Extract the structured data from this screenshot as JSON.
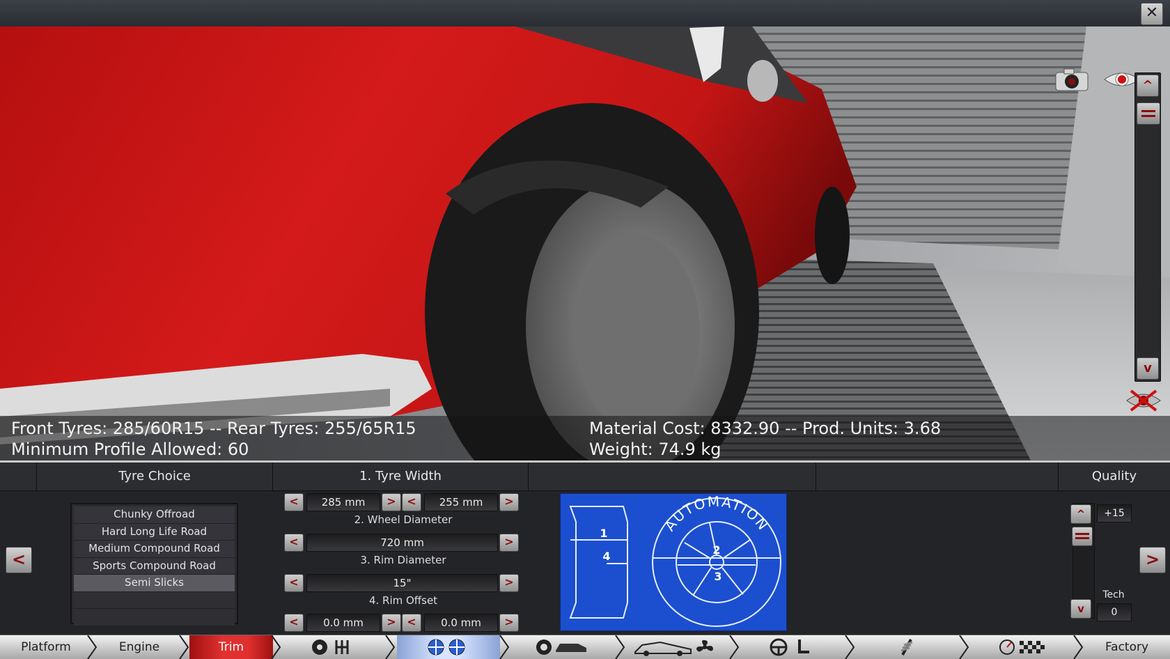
{
  "window": {
    "close_label": "✕"
  },
  "scene": {
    "front_tyres_text": "Front Tyres: 285/60R15 -- Rear Tyres: 255/65R15",
    "min_profile_text": "Minimum Profile Allowed: 60",
    "material_cost_text": "Material Cost: 8332.90 -- Prod. Units: 3.68",
    "weight_text": "Weight: 74.9 kg",
    "zoom_up": "^",
    "zoom_down": "v"
  },
  "panel": {
    "tyre_choice_title": "Tyre Choice",
    "tyre_width_title": "1. Tyre Width",
    "quality_title": "Quality",
    "prev_arrow": "<",
    "next_arrow": ">",
    "tyre_choices": [
      "Chunky Offroad",
      "Hard Long Life Road",
      "Medium Compound Road",
      "Sports Compound Road",
      "Semi Slicks"
    ],
    "selected_tyre": "Semi Slicks",
    "front_width": "285 mm",
    "rear_width": "255 mm",
    "wheel_diameter_label": "2. Wheel Diameter",
    "wheel_diameter": "720 mm",
    "rim_diameter_label": "3. Rim Diameter",
    "rim_diameter": "15\"",
    "rim_offset_label": "4. Rim Offset",
    "front_offset": "0.0 mm",
    "rear_offset": "0.0 mm",
    "dec": "<",
    "inc": ">",
    "blueprint_brand": "AUTOMATION",
    "blueprint_marks": [
      "1",
      "2",
      "3",
      "4"
    ],
    "quality_up": "^",
    "quality_down": "v",
    "quality_value": "+15",
    "tech_label": "Tech",
    "tech_value": "0"
  },
  "navbar": {
    "platform": "Platform",
    "engine": "Engine",
    "trim": "Trim",
    "factory": "Factory"
  },
  "colors": {
    "accent_red": "#8a0d0d",
    "car_red": "#c81414",
    "blueprint_blue": "#1b4fcf"
  }
}
